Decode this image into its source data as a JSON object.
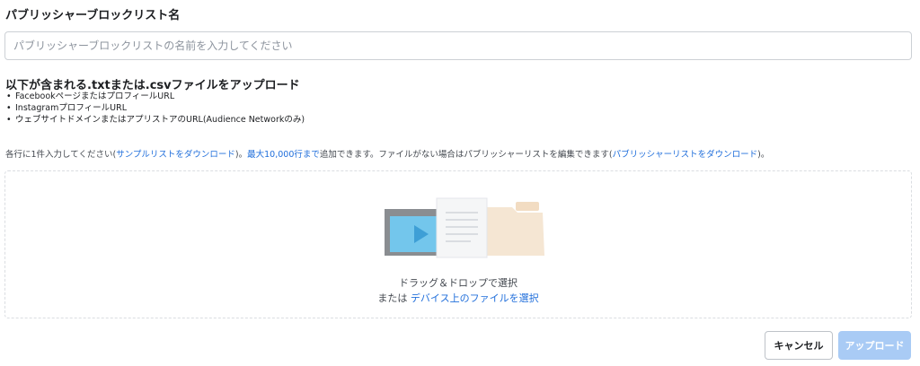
{
  "name_field": {
    "label": "パブリッシャーブロックリスト名",
    "placeholder": "パブリッシャーブロックリストの名前を入力してください"
  },
  "upload_section": {
    "heading": "以下が含まれる.txtまたは.csvファイルをアップロード",
    "requirements": [
      "FacebookページまたはプロフィールURL",
      "InstagramプロフィールURL",
      "ウェブサイトドメインまたはアプリストアのURL(Audience Networkのみ)"
    ]
  },
  "help": {
    "part1": "各行に1件入力してください(",
    "sample_link": "サンプルリストをダウンロード",
    "part2": ")。",
    "max_link": "最大10,000行まで",
    "part3": "追加できます。ファイルがない場合はパブリッシャーリストを編集できます(",
    "publisher_link": "パブリッシャーリストをダウンロード",
    "part4": ")。"
  },
  "dropzone": {
    "drag_text": "ドラッグ＆ドロップで選択",
    "or_text": "または",
    "select_link": "デバイス上のファイルを選択",
    "icon": "file-upload-illustration",
    "colors": {
      "video_frame": "#8a8d91",
      "video_screen": "#73c6ec",
      "play_button": "#3e9fd6",
      "document": "#f5f6f7",
      "folder": "#f5e6d3"
    }
  },
  "actions": {
    "cancel_label": "キャンセル",
    "upload_label": "アップロード",
    "upload_color": "#a9cbf5"
  }
}
